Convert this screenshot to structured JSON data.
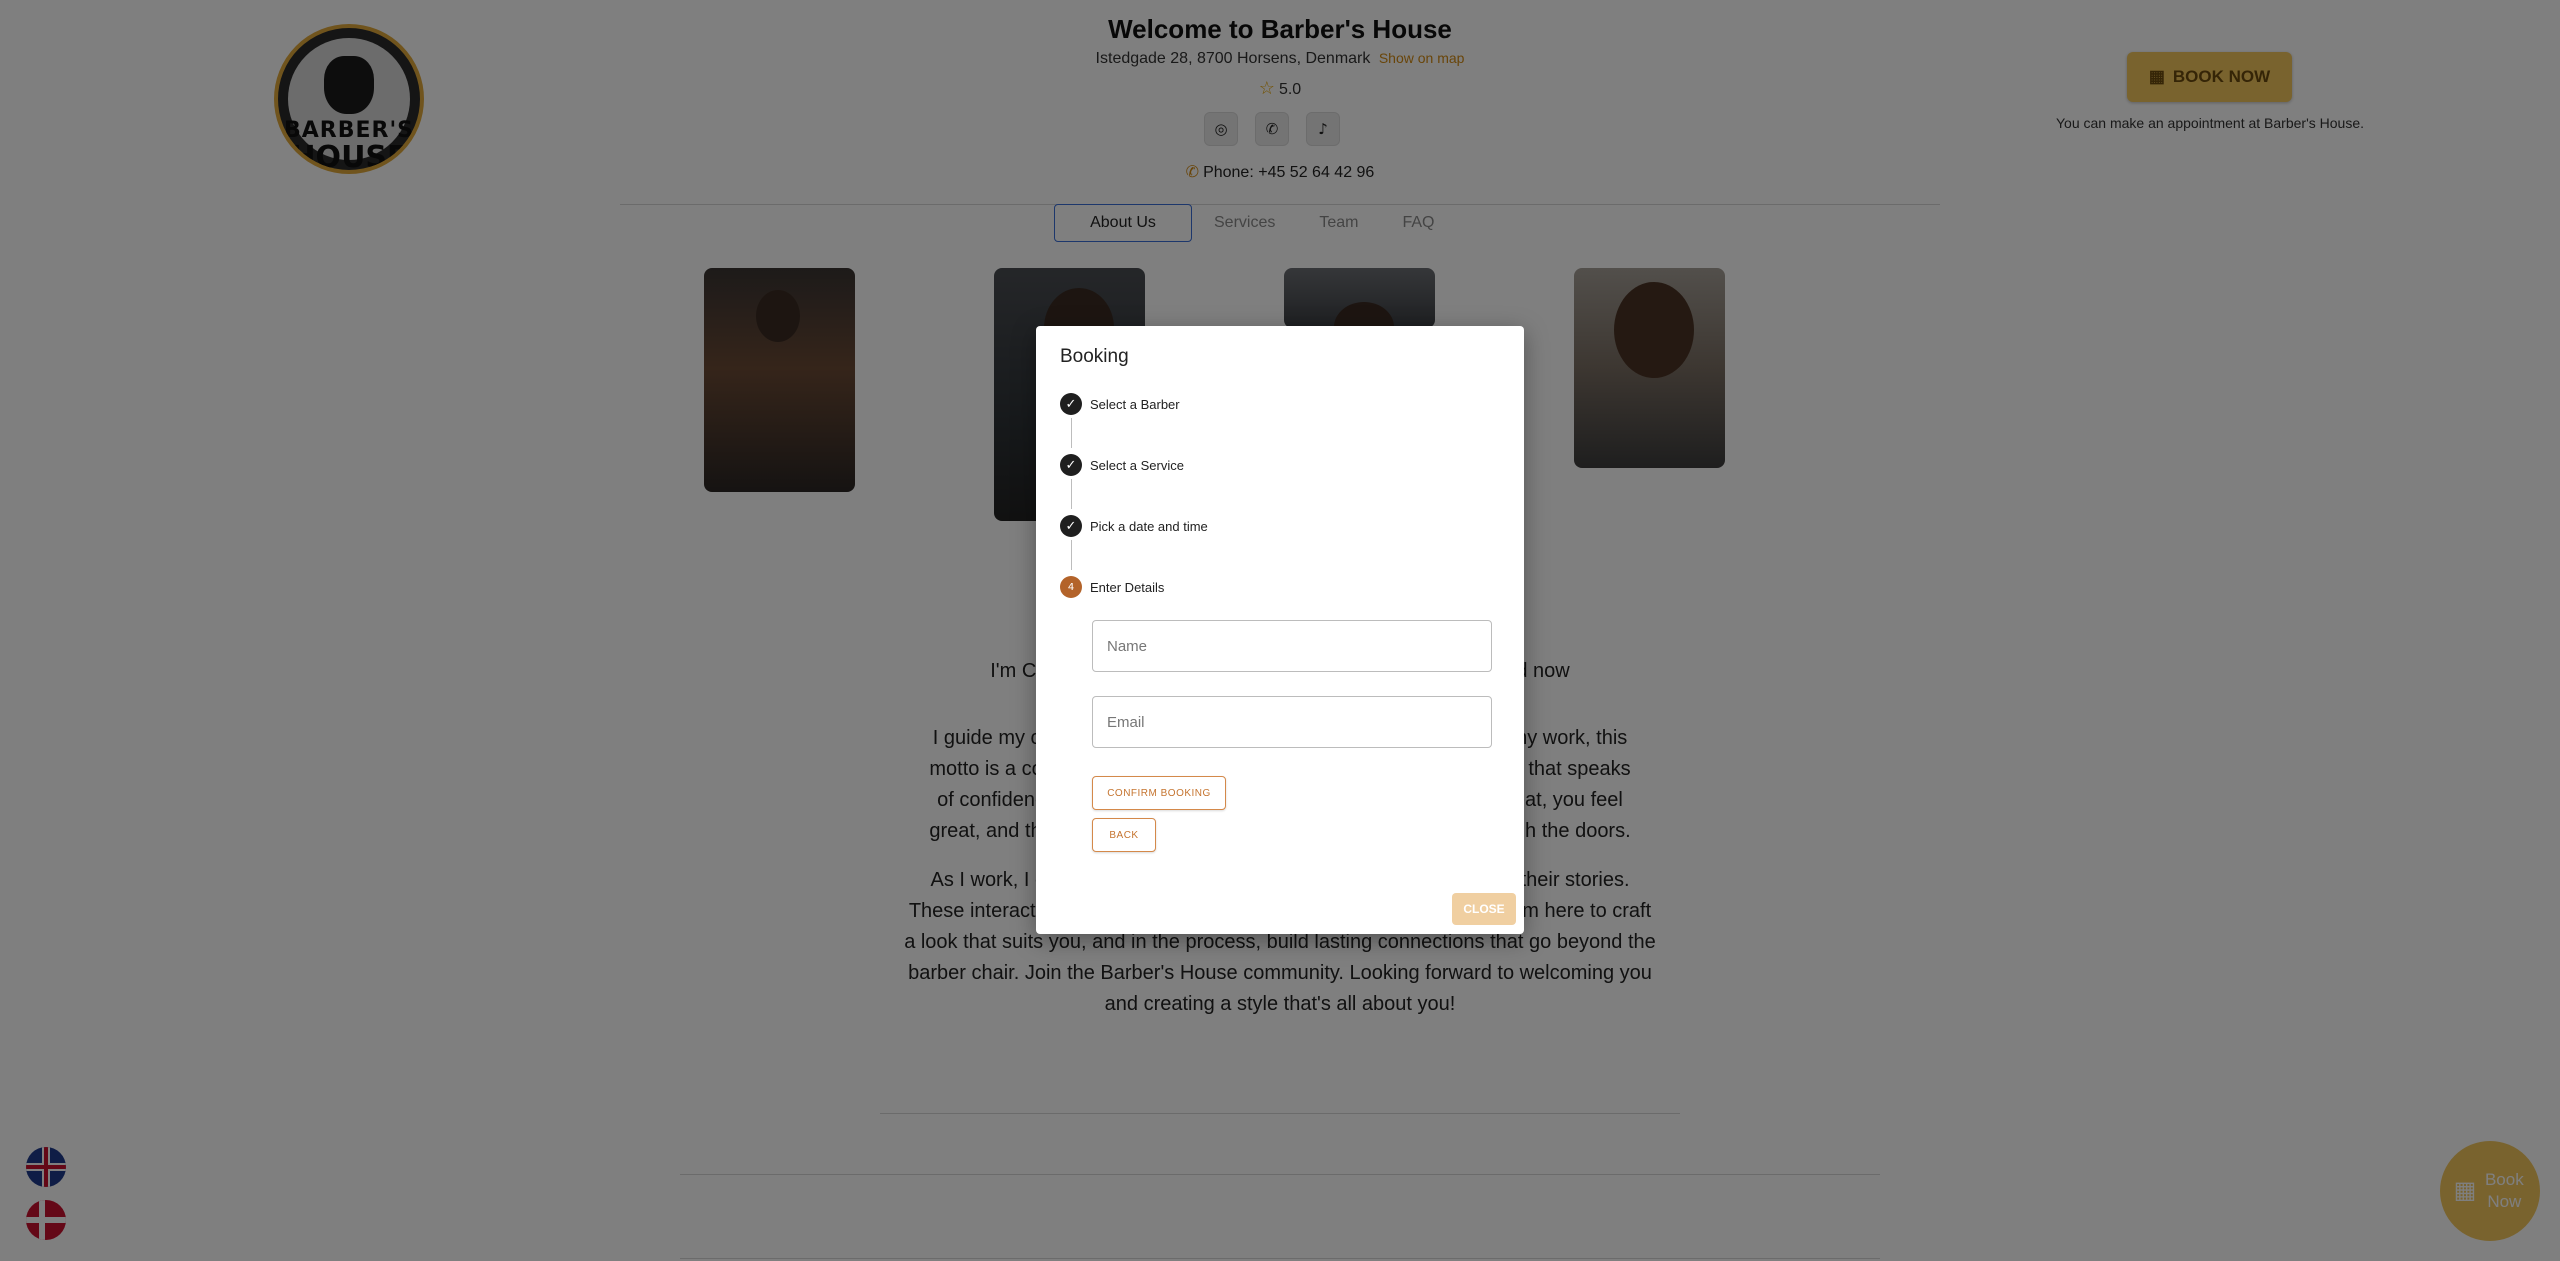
{
  "header": {
    "logo_text_top": "BARBER'S",
    "logo_text_bottom": "HOUSE",
    "title": "Welcome to Barber's House",
    "address": "Istedgade 28, 8700 Horsens, Denmark",
    "show_on_map": "Show on map",
    "rating": "5.0",
    "phone": "Phone: +45 52 64 42 96",
    "book_now": "BOOK NOW",
    "appointment_note": "You can make an appointment at Barber's House."
  },
  "socials": [
    {
      "name": "instagram-icon",
      "glyph": "◎"
    },
    {
      "name": "whatsapp-icon",
      "glyph": "✆"
    },
    {
      "name": "tiktok-icon",
      "glyph": "♪"
    }
  ],
  "tabs": [
    {
      "label": "About Us",
      "active": true
    },
    {
      "label": "Services",
      "active": false
    },
    {
      "label": "Team",
      "active": false
    },
    {
      "label": "FAQ",
      "active": false
    }
  ],
  "about": {
    "p1_line1_left": "I'm Ciprian Maft",
    "p1_line1_right": "passion and now",
    "p2_lines_left": [
      "I guide my craf",
      "motto is a const",
      "of confidence",
      "great, and tha"
    ],
    "p2_lines_right": [
      "n my work, this",
      "ude that speaks",
      "great, you feel",
      "ugh the doors."
    ],
    "p3_line1_left": "As I work, I enjo",
    "p3_line1_right": "nd their stories.",
    "p3_line2_left": "These interactio",
    "p3_line2_right": "am here to craft",
    "p3_rest": "a look that suits you, and in the process, build lasting connections that go beyond the barber chair. Join the Barber's House community. Looking forward to welcoming you and creating a style that's all about you!"
  },
  "fab": {
    "label": "Book Now"
  },
  "modal": {
    "title": "Booking",
    "steps": [
      {
        "label": "Select a Barber",
        "state": "done"
      },
      {
        "label": "Select a Service",
        "state": "done"
      },
      {
        "label": "Pick a date and time",
        "state": "done"
      },
      {
        "label": "Enter Details",
        "state": "active",
        "number": "4"
      }
    ],
    "name_placeholder": "Name",
    "email_placeholder": "Email",
    "confirm_label": "CONFIRM BOOKING",
    "back_label": "BACK",
    "close_label": "CLOSE"
  },
  "colors": {
    "accent": "#f3c75d",
    "link": "#d28a12",
    "step_active": "#b3632a",
    "outline_button": "#c5742f",
    "tab_active_border": "#3b6fd8"
  }
}
